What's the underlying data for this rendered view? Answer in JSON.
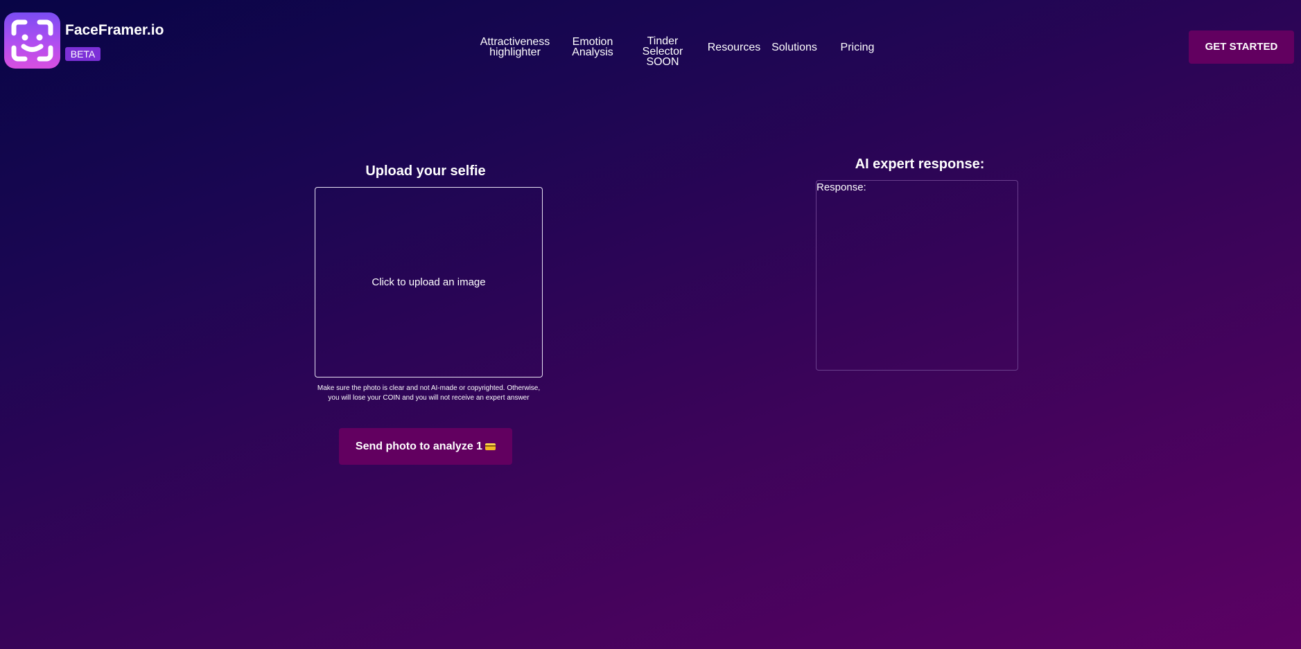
{
  "brand": {
    "name": "FaceFramer.io",
    "badge": "BETA",
    "logo_icon": "face-frame-icon"
  },
  "nav": {
    "items": [
      {
        "label": "Attractiveness\nhighlighter"
      },
      {
        "label": "Emotion\nAnalysis"
      },
      {
        "label": "Tinder\nSelector\nSOON"
      },
      {
        "label": "Resources"
      },
      {
        "label": "Solutions"
      },
      {
        "label": "Pricing"
      }
    ],
    "cta_label": "GET STARTED"
  },
  "upload": {
    "title": "Upload your selfie",
    "placeholder": "Click to upload an image",
    "note": "Make sure the photo is clear and not AI-made or copyrighted. Otherwise, you will lose your COIN and you will not receive an expert answer",
    "send_label": "Send photo to analyze 1",
    "coin_icon": "coin-card-icon"
  },
  "response": {
    "title": "AI expert response:",
    "label": "Response:"
  },
  "colors": {
    "bg_top": "#080546",
    "bg_bottom": "#5c0163",
    "button": "#620060",
    "badge": "#7c30d7"
  }
}
